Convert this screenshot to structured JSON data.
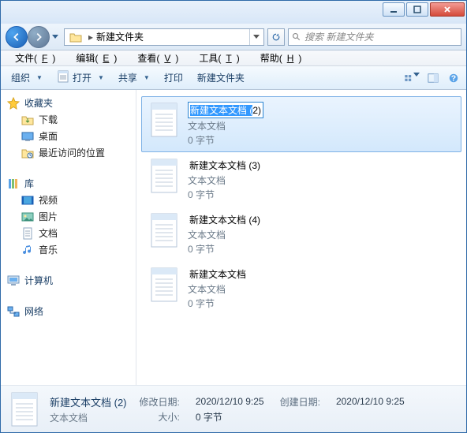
{
  "titlebar": {},
  "nav": {
    "folder_name": "新建文件夹",
    "search_placeholder": "搜索 新建文件夹"
  },
  "menu": {
    "file": "文件(",
    "file_u": "F",
    "file2": ")",
    "edit": "编辑(",
    "edit_u": "E",
    "edit2": ")",
    "view": "查看(",
    "view_u": "V",
    "view2": ")",
    "tools": "工具(",
    "tools_u": "T",
    "tools2": ")",
    "help": "帮助(",
    "help_u": "H",
    "help2": ")"
  },
  "toolbar": {
    "organize": "组织",
    "open": "打开",
    "share": "共享",
    "print": "打印",
    "newfolder": "新建文件夹"
  },
  "sidebar": {
    "fav_hdr": "收藏夹",
    "fav_items": [
      "下载",
      "桌面",
      "最近访问的位置"
    ],
    "lib_hdr": "库",
    "lib_items": [
      "视频",
      "图片",
      "文档",
      "音乐"
    ],
    "computer_hdr": "计算机",
    "network_hdr": "网络"
  },
  "files": [
    {
      "name_a": "新建文本文档 (",
      "name_b": "2)",
      "type": "文本文档",
      "size": "0 字节",
      "editing": true
    },
    {
      "name": "新建文本文档 (3)",
      "type": "文本文档",
      "size": "0 字节"
    },
    {
      "name": "新建文本文档 (4)",
      "type": "文本文档",
      "size": "0 字节"
    },
    {
      "name": "新建文本文档",
      "type": "文本文档",
      "size": "0 字节"
    }
  ],
  "details": {
    "title": "新建文本文档 (2)",
    "subtitle": "文本文档",
    "mod_label": "修改日期:",
    "mod_val": "2020/12/10 9:25",
    "created_label": "创建日期:",
    "created_val": "2020/12/10 9:25",
    "size_label": "大小:",
    "size_val": "0 字节"
  }
}
